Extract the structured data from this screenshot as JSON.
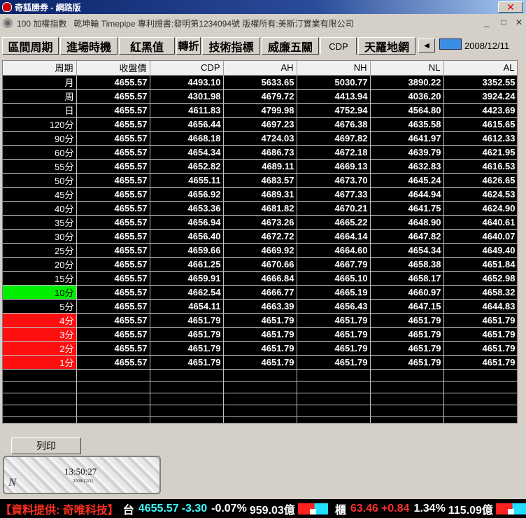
{
  "window": {
    "title": "奇狐勝券 - 網路版"
  },
  "subbar": {
    "index_label": "100 加權指數",
    "notice": "乾坤輪 Timepipe 專利證書:發明第1234094號 版權所有:美斯汀實業有限公司"
  },
  "tabs": [
    {
      "label": "區間周期",
      "active": false
    },
    {
      "label": "進場時機",
      "active": false
    },
    {
      "label": "紅黑值",
      "active": false
    },
    {
      "label": "轉折",
      "active": false
    },
    {
      "label": "技術指標",
      "active": false
    },
    {
      "label": "威廉五關",
      "active": false
    },
    {
      "label": "CDP",
      "active": true
    },
    {
      "label": "天羅地網",
      "active": false
    }
  ],
  "date": "2008/12/11",
  "table": {
    "headers": [
      "周期",
      "收盤價",
      "CDP",
      "AH",
      "NH",
      "NL",
      "AL"
    ],
    "rows": [
      {
        "period": "月",
        "close": "4655.57",
        "cdp": "4493.10",
        "ah": "5633.65",
        "nh": "5030.77",
        "nl": "3890.22",
        "al": "3352.55",
        "highlight": ""
      },
      {
        "period": "周",
        "close": "4655.57",
        "cdp": "4301.98",
        "ah": "4679.72",
        "nh": "4413.94",
        "nl": "4036.20",
        "al": "3924.24",
        "highlight": ""
      },
      {
        "period": "日",
        "close": "4655.57",
        "cdp": "4611.83",
        "ah": "4799.98",
        "nh": "4752.94",
        "nl": "4564.80",
        "al": "4423.69",
        "highlight": ""
      },
      {
        "period": "120分",
        "close": "4655.57",
        "cdp": "4656.44",
        "ah": "4697.23",
        "nh": "4676.38",
        "nl": "4635.58",
        "al": "4615.65",
        "highlight": ""
      },
      {
        "period": "90分",
        "close": "4655.57",
        "cdp": "4668.18",
        "ah": "4724.03",
        "nh": "4697.82",
        "nl": "4641.97",
        "al": "4612.33",
        "highlight": ""
      },
      {
        "period": "60分",
        "close": "4655.57",
        "cdp": "4654.34",
        "ah": "4686.73",
        "nh": "4672.18",
        "nl": "4639.79",
        "al": "4621.95",
        "highlight": ""
      },
      {
        "period": "55分",
        "close": "4655.57",
        "cdp": "4652.82",
        "ah": "4689.11",
        "nh": "4669.13",
        "nl": "4632.83",
        "al": "4616.53",
        "highlight": ""
      },
      {
        "period": "50分",
        "close": "4655.57",
        "cdp": "4655.11",
        "ah": "4683.57",
        "nh": "4673.70",
        "nl": "4645.24",
        "al": "4626.65",
        "highlight": ""
      },
      {
        "period": "45分",
        "close": "4655.57",
        "cdp": "4656.92",
        "ah": "4689.31",
        "nh": "4677.33",
        "nl": "4644.94",
        "al": "4624.53",
        "highlight": ""
      },
      {
        "period": "40分",
        "close": "4655.57",
        "cdp": "4653.36",
        "ah": "4681.82",
        "nh": "4670.21",
        "nl": "4641.75",
        "al": "4624.90",
        "highlight": ""
      },
      {
        "period": "35分",
        "close": "4655.57",
        "cdp": "4656.94",
        "ah": "4673.26",
        "nh": "4665.22",
        "nl": "4648.90",
        "al": "4640.61",
        "highlight": ""
      },
      {
        "period": "30分",
        "close": "4655.57",
        "cdp": "4656.40",
        "ah": "4672.72",
        "nh": "4664.14",
        "nl": "4647.82",
        "al": "4640.07",
        "highlight": ""
      },
      {
        "period": "25分",
        "close": "4655.57",
        "cdp": "4659.66",
        "ah": "4669.92",
        "nh": "4664.60",
        "nl": "4654.34",
        "al": "4649.40",
        "highlight": ""
      },
      {
        "period": "20分",
        "close": "4655.57",
        "cdp": "4661.25",
        "ah": "4670.66",
        "nh": "4667.79",
        "nl": "4658.38",
        "al": "4651.84",
        "highlight": ""
      },
      {
        "period": "15分",
        "close": "4655.57",
        "cdp": "4659.91",
        "ah": "4666.84",
        "nh": "4665.10",
        "nl": "4658.17",
        "al": "4652.98",
        "highlight": ""
      },
      {
        "period": "10分",
        "close": "4655.57",
        "cdp": "4662.54",
        "ah": "4666.77",
        "nh": "4665.19",
        "nl": "4660.97",
        "al": "4658.32",
        "highlight": "green"
      },
      {
        "period": "5分",
        "close": "4655.57",
        "cdp": "4654.11",
        "ah": "4663.39",
        "nh": "4656.43",
        "nl": "4647.15",
        "al": "4644.83",
        "highlight": ""
      },
      {
        "period": "4分",
        "close": "4655.57",
        "cdp": "4651.79",
        "ah": "4651.79",
        "nh": "4651.79",
        "nl": "4651.79",
        "al": "4651.79",
        "highlight": "red"
      },
      {
        "period": "3分",
        "close": "4655.57",
        "cdp": "4651.79",
        "ah": "4651.79",
        "nh": "4651.79",
        "nl": "4651.79",
        "al": "4651.79",
        "highlight": "red"
      },
      {
        "period": "2分",
        "close": "4655.57",
        "cdp": "4651.79",
        "ah": "4651.79",
        "nh": "4651.79",
        "nl": "4651.79",
        "al": "4651.79",
        "highlight": "red"
      },
      {
        "period": "1分",
        "close": "4655.57",
        "cdp": "4651.79",
        "ah": "4651.79",
        "nh": "4651.79",
        "nl": "4651.79",
        "al": "4651.79",
        "highlight": "red"
      }
    ]
  },
  "buttons": {
    "print_label": "列印"
  },
  "clock": {
    "time": "13:50:27",
    "date": "2008/12/11",
    "logo": "N"
  },
  "ticker": {
    "source": "【資料提供: 奇唯科技】",
    "taiex_label": "台",
    "taiex_value": "4655.57",
    "taiex_change": "-3.30",
    "taiex_pct": "-0.07%",
    "taiex_volume": "959.03億",
    "otc_label": "櫃",
    "otc_value": "63.46",
    "otc_change": "+0.84",
    "otc_pct": "1.34%",
    "otc_volume": "115.09億"
  },
  "colors": {
    "highlight_green": "#00ee00",
    "highlight_red": "#ff1010",
    "grid_bg": "#000000",
    "titlebar": "#0a246a"
  }
}
